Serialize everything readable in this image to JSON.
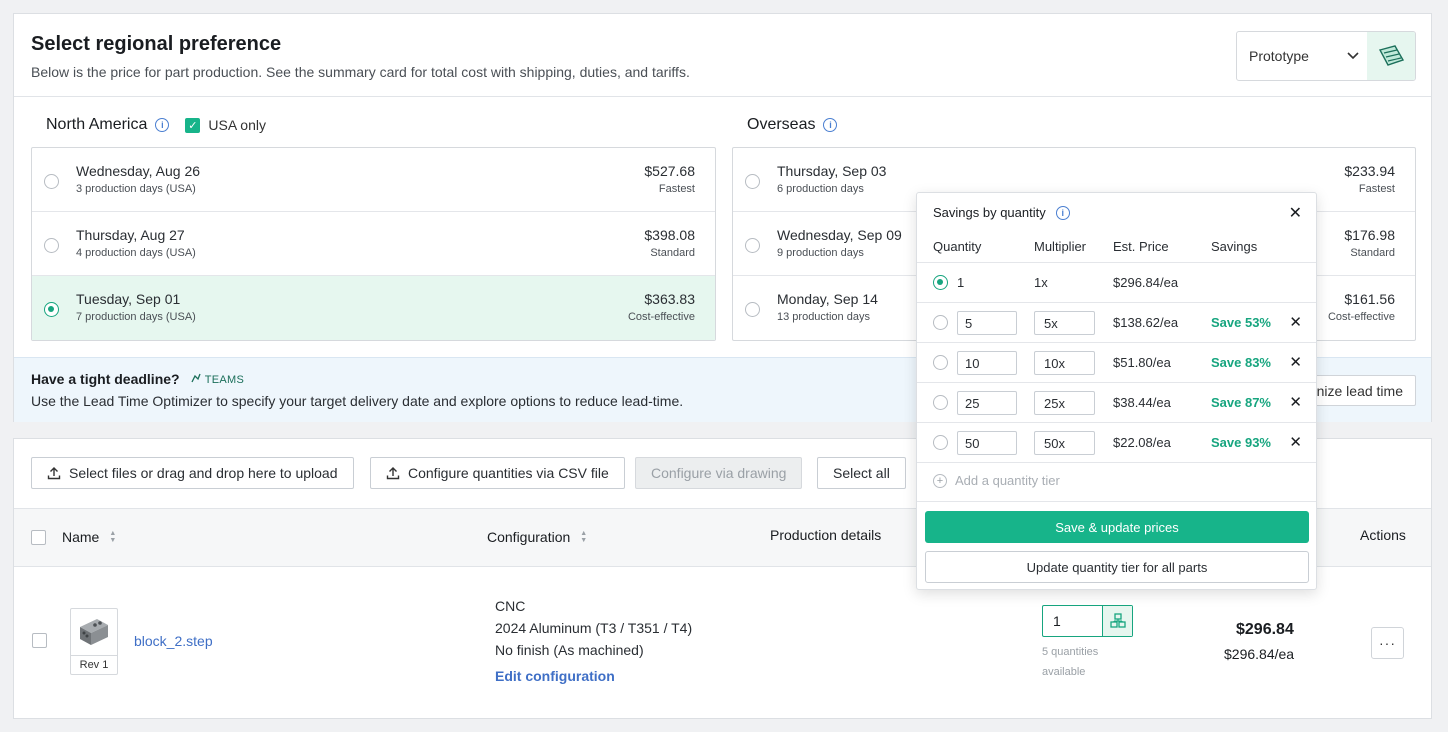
{
  "header": {
    "title": "Select regional preference",
    "subtitle": "Below is the price for part production. See the summary card for total cost with shipping, duties, and tariffs.",
    "mode_select": "Prototype"
  },
  "north_america": {
    "label": "North America",
    "usa_only_label": "USA only",
    "usa_only_checked": true,
    "options": [
      {
        "date": "Wednesday, Aug 26",
        "days": "3 production days (USA)",
        "price": "$527.68",
        "tag": "Fastest",
        "selected": false
      },
      {
        "date": "Thursday, Aug 27",
        "days": "4 production days (USA)",
        "price": "$398.08",
        "tag": "Standard",
        "selected": false
      },
      {
        "date": "Tuesday, Sep 01",
        "days": "7 production days (USA)",
        "price": "$363.83",
        "tag": "Cost-effective",
        "selected": true
      }
    ]
  },
  "overseas": {
    "label": "Overseas",
    "options": [
      {
        "date": "Thursday, Sep 03",
        "days": "6 production days",
        "price": "$233.94",
        "tag": "Fastest"
      },
      {
        "date": "Wednesday, Sep 09",
        "days": "9 production days",
        "price": "$176.98",
        "tag": "Standard"
      },
      {
        "date": "Monday, Sep 14",
        "days": "13 production days",
        "price": "$161.56",
        "tag": "Cost-effective"
      }
    ]
  },
  "deadline": {
    "heading": "Have a tight deadline?",
    "teams_badge": "TEAMS",
    "text": "Use the Lead Time Optimizer to specify your target delivery date and explore options to reduce lead-time.",
    "button": "nize lead time"
  },
  "toolbar": {
    "upload": "Select files or drag and drop here to upload",
    "csv": "Configure quantities via CSV file",
    "drawing": "Configure via drawing",
    "select_all": "Select all"
  },
  "table": {
    "col_name": "Name",
    "col_config": "Configuration",
    "col_production": "Production details",
    "col_actions": "Actions"
  },
  "part": {
    "rev": "Rev 1",
    "filename_base": "block_2",
    "filename_ext": ".step",
    "process": "CNC",
    "material": "2024 Aluminum (T3 / T351 / T4)",
    "finish": "No finish (As machined)",
    "edit_link": "Edit configuration",
    "quantity": "1",
    "quantities_available": "5 quantities available",
    "total": "$296.84",
    "each": "$296.84/ea"
  },
  "savings_popover": {
    "title": "Savings by quantity",
    "headers": {
      "quantity": "Quantity",
      "multiplier": "Multiplier",
      "price": "Est. Price",
      "savings": "Savings"
    },
    "rows": [
      {
        "qty": "1",
        "mult": "1x",
        "price": "$296.84/ea",
        "savings": "",
        "selected": true
      },
      {
        "qty": "5",
        "mult": "5x",
        "price": "$138.62/ea",
        "savings": "Save 53%"
      },
      {
        "qty": "10",
        "mult": "10x",
        "price": "$51.80/ea",
        "savings": "Save 83%"
      },
      {
        "qty": "25",
        "mult": "25x",
        "price": "$38.44/ea",
        "savings": "Save 87%"
      },
      {
        "qty": "50",
        "mult": "50x",
        "price": "$22.08/ea",
        "savings": "Save 93%"
      }
    ],
    "add_tier": "Add a quantity tier",
    "save_button": "Save & update prices",
    "update_all_button": "Update quantity tier for all parts"
  },
  "colors": {
    "accent": "#17b48a",
    "link": "#3f6fc6",
    "selected_bg": "#e6f7ef"
  }
}
